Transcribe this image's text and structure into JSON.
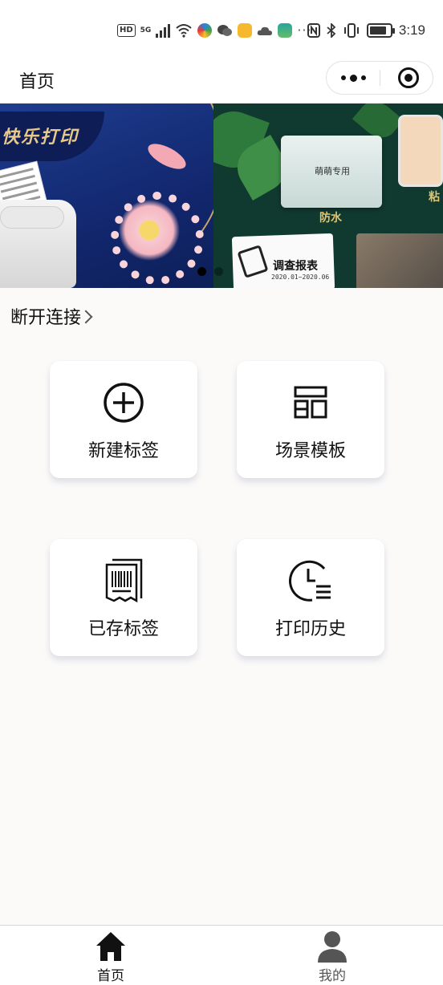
{
  "status_bar": {
    "hd": "HD",
    "network": "5G",
    "time": "3:19"
  },
  "nav": {
    "title": "首页"
  },
  "banner": {
    "slide1_brand": "快乐打印",
    "slide2_tape_label": "萌萌专用",
    "slide2_waterproof": "防水",
    "slide2_sticky": "粘",
    "slide2_report_title": "调查报表",
    "slide2_report_date": "2020.01~2020.06",
    "active_dot": 0,
    "dot_count": 2
  },
  "connection": {
    "label": "断开连接"
  },
  "grid": {
    "items": [
      {
        "label": "新建标签",
        "icon": "add-circle-icon"
      },
      {
        "label": "场景模板",
        "icon": "template-icon"
      },
      {
        "label": "已存标签",
        "icon": "saved-receipt-icon"
      },
      {
        "label": "打印历史",
        "icon": "history-clock-icon"
      }
    ]
  },
  "tabbar": {
    "items": [
      {
        "label": "首页",
        "icon": "home-icon",
        "active": true
      },
      {
        "label": "我的",
        "icon": "user-icon",
        "active": false
      }
    ]
  },
  "colors": {
    "active_tab": "#111111",
    "inactive_tab": "#555555",
    "banner_gold": "#e8c98c",
    "page_bg": "#fbfaf9"
  }
}
